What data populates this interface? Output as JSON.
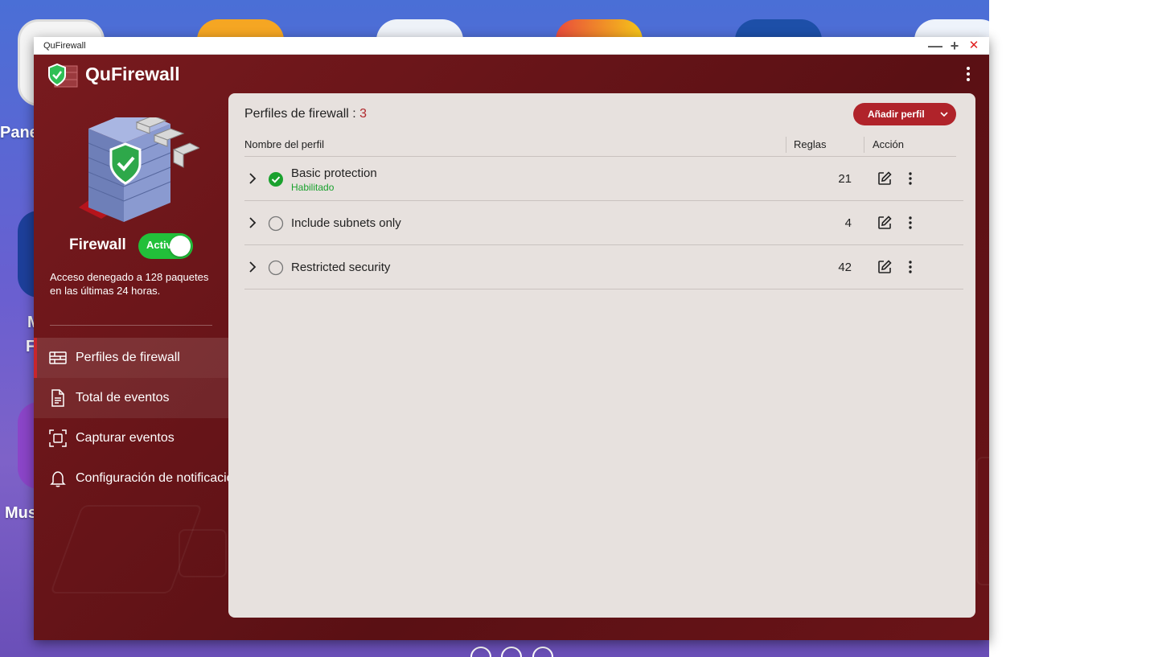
{
  "desktop": {
    "labels": [
      "Pane",
      "M",
      "F",
      "Mus"
    ]
  },
  "window": {
    "title": "QuFirewall",
    "controls": {
      "minimize": "—",
      "maximize": "+",
      "close": "✕"
    }
  },
  "app": {
    "name": "QuFirewall"
  },
  "sidebar": {
    "firewall_label": "Firewall",
    "toggle_label": "Activado",
    "description": "Acceso denegado a 128 paquetes en las últimas 24 horas.",
    "nav": [
      {
        "label": "Perfiles de firewall",
        "icon": "firewall-icon"
      },
      {
        "label": "Total de eventos",
        "icon": "document-icon"
      },
      {
        "label": "Capturar eventos",
        "icon": "capture-icon"
      },
      {
        "label": "Configuración de notificaciones",
        "icon": "bell-icon"
      }
    ]
  },
  "main": {
    "title_prefix": "Perfiles de firewall :",
    "profile_count": "3",
    "add_button": "Añadir perfil",
    "columns": {
      "name": "Nombre del perfil",
      "rules": "Reglas",
      "action": "Acción"
    },
    "profiles": [
      {
        "name": "Basic protection",
        "status": "Habilitado",
        "enabled": true,
        "rules": "21"
      },
      {
        "name": "Include subnets only",
        "status": "",
        "enabled": false,
        "rules": "4"
      },
      {
        "name": "Restricted security",
        "status": "",
        "enabled": false,
        "rules": "42"
      }
    ]
  },
  "colors": {
    "accent": "#b0232a",
    "enabled_green": "#1aa12e",
    "toggle_green": "#22c03a",
    "window_bg": "#6e1418",
    "panel_bg": "#e7e1de"
  }
}
